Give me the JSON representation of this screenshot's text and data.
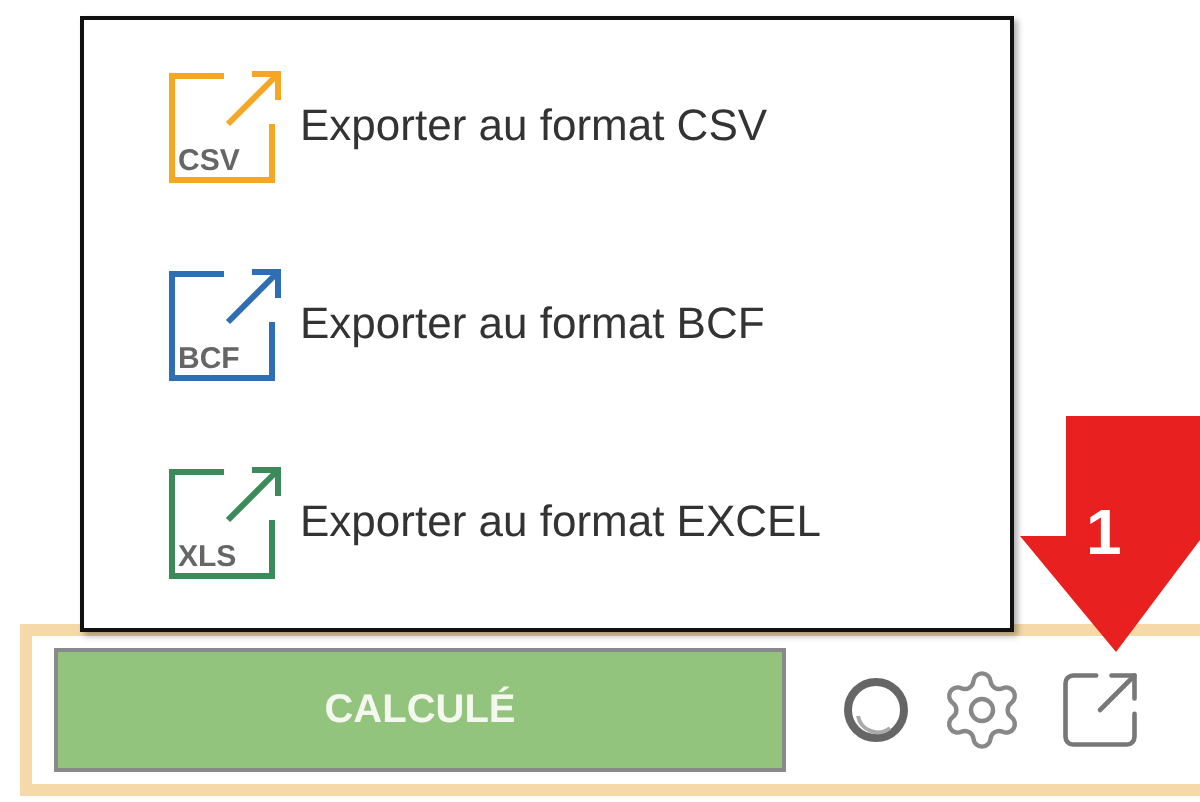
{
  "export_menu": {
    "items": [
      {
        "label": "Exporter au format CSV",
        "format": "CSV",
        "color": "#f5a623"
      },
      {
        "label": "Exporter au format BCF",
        "format": "BCF",
        "color": "#2f6db5"
      },
      {
        "label": "Exporter au format EXCEL",
        "format": "XLS",
        "color": "#3a8a5a"
      }
    ]
  },
  "toolbar": {
    "status_button": "CALCULÉ"
  },
  "annotation": {
    "number": "1"
  }
}
